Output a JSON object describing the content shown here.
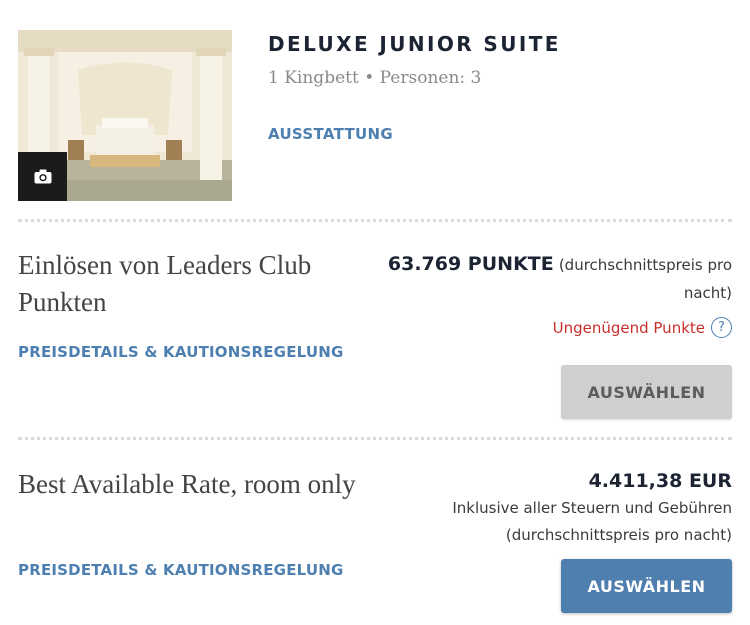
{
  "room": {
    "title": "DELUXE JUNIOR SUITE",
    "details": "1 Kingbett • Personen: 3",
    "amenities_link": "AUSSTATTUNG",
    "photo_button_icon": "camera-icon"
  },
  "rates": [
    {
      "title": "Einlösen von Leaders Club Punkten",
      "price_details_link": "PREISDETAILS & KAUTIONSREGELUNG",
      "amount": "63.769 PUNKTE",
      "amount_note": "(durchschnittspreis pro nacht)",
      "warning": "Ungenügend Punkte",
      "warning_icon": "help-circle-icon",
      "button_label": "AUSWÄHLEN",
      "button_state": "disabled"
    },
    {
      "title": "Best Available Rate, room only",
      "price_details_link": "PREISDETAILS & KAUTIONSREGELUNG",
      "amount": "4.411,38 EUR",
      "tax_note": "Inklusive aller Steuern und Gebühren",
      "amount_note": "(durchschnittspreis pro nacht)",
      "button_label": "AUSWÄHLEN",
      "button_state": "enabled"
    }
  ],
  "colors": {
    "link": "#4d7fb1",
    "warning": "#c8302b",
    "primary_button": "#4f7fae",
    "disabled_button": "#cfcfcf"
  }
}
